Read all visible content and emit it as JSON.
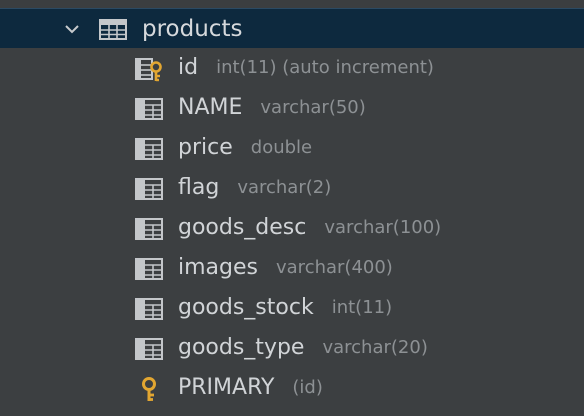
{
  "table": {
    "name": "products",
    "icon": "table-icon",
    "expanded": true
  },
  "columns": [
    {
      "name": "id",
      "type": "int(11) (auto increment)",
      "icon": "primary-key-column-icon"
    },
    {
      "name": "NAME",
      "type": "varchar(50)",
      "icon": "column-icon"
    },
    {
      "name": "price",
      "type": "double",
      "icon": "column-icon"
    },
    {
      "name": "flag",
      "type": "varchar(2)",
      "icon": "column-icon"
    },
    {
      "name": "goods_desc",
      "type": "varchar(100)",
      "icon": "column-icon"
    },
    {
      "name": "images",
      "type": "varchar(400)",
      "icon": "column-icon"
    },
    {
      "name": "goods_stock",
      "type": "int(11)",
      "icon": "column-icon"
    },
    {
      "name": "goods_type",
      "type": "varchar(20)",
      "icon": "column-icon"
    }
  ],
  "keys": [
    {
      "name": "PRIMARY",
      "type": "(id)",
      "icon": "key-icon"
    }
  ],
  "colors": {
    "background": "#3c3f41",
    "selection": "#0d293e",
    "text": "#d1d4d7",
    "type_text": "#8d9194",
    "key_gold": "#e2a631"
  }
}
